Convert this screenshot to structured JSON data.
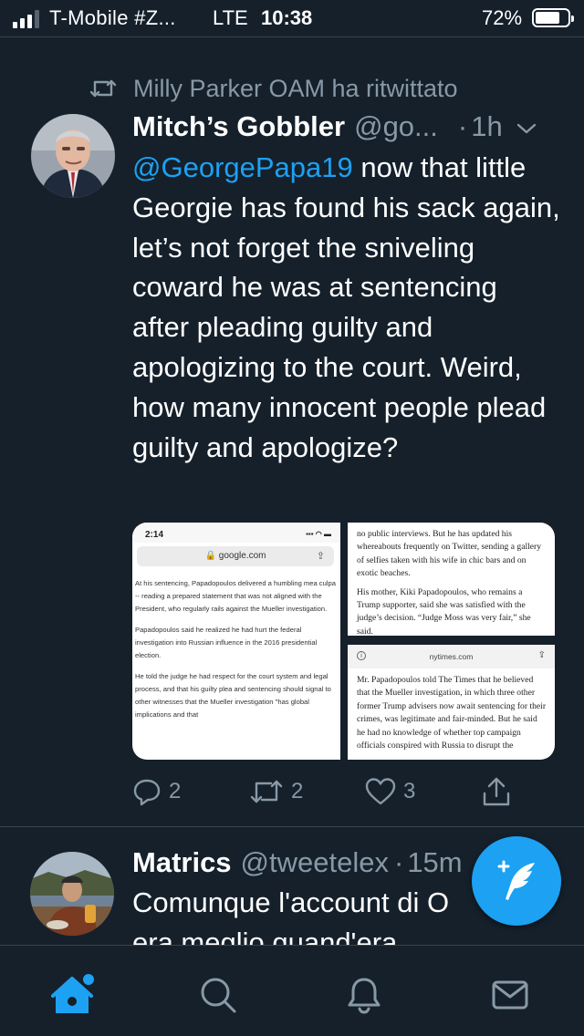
{
  "status_bar": {
    "carrier": "T-Mobile #Z...",
    "network": "LTE",
    "time": "10:38",
    "battery_percent": "72%",
    "battery_level": 0.72,
    "signal_bars": 3,
    "signal_max": 4
  },
  "timeline": {
    "tweets": [
      {
        "retweet_label": "Milly Parker OAM ha ritwittato",
        "name": "Mitch’s Gobbler",
        "handle": "@go...",
        "separator": "·",
        "time": "1h",
        "mention": "@GeorgePapa19",
        "text": " now that little Georgie has found his sack again, let’s not forget the sniveling coward he was at sentencing after pleading guilty and apologizing to the court. Weird, how many innocent people plead guilty and apologize?",
        "media": {
          "left": {
            "status_time": "2:14",
            "status_icons": "▪▪▪ ◠ ▬",
            "url": "🔒 google.com",
            "share": "⇪",
            "paragraphs": [
              "At his sentencing, Papadopoulos delivered a humbling mea culpa -- reading a prepared statement that was not aligned with the President, who regularly rails against the Mueller investigation.",
              "Papadopoulos said he realized he had hurt the federal investigation into Russian influence in the 2016 presidential election.",
              "He told the judge he had respect for the court system and legal process, and that his guilty plea and sentencing should signal to other witnesses that the Mueller investigation \"has global implications and that"
            ]
          },
          "right_top": {
            "paragraphs": [
              "no public interviews. But he has updated his whereabouts frequently on Twitter, sending a gallery of selfies taken with his wife in chic bars and on exotic beaches.",
              "His mother, Kiki Papadopoulos, who remains a Trump supporter, said she was satisfied with the judge’s decision. “Judge Moss was very fair,” she said."
            ]
          },
          "right_bottom": {
            "info": "i",
            "url": "nytimes.com",
            "share": "⇪",
            "paragraphs": [
              "Mr. Papadopoulos told The Times that he believed that the Mueller investigation, in which three other former Trump advisers now await sentencing for their crimes, was legitimate and fair-minded. But he said he had no knowledge of whether top campaign officials conspired with Russia to disrupt the"
            ]
          }
        },
        "actions": {
          "reply_count": "2",
          "retweet_count": "2",
          "like_count": "3"
        }
      },
      {
        "name": "Matrics",
        "handle": "@tweetelex",
        "separator": "·",
        "time": "15m",
        "text_line1": "Comunque l'account di O",
        "text_line2": "era meglio quand'era"
      }
    ]
  },
  "icons": {
    "retweet": "retweet-icon",
    "reply": "reply-icon",
    "like": "heart-icon",
    "share": "share-icon",
    "compose": "compose-feather-icon",
    "home": "home-icon",
    "search": "search-icon",
    "notifications": "bell-icon",
    "messages": "envelope-icon"
  },
  "colors": {
    "background": "#15202b",
    "accent": "#1da1f2",
    "secondary_text": "#8899a6",
    "divider": "#38444d"
  }
}
